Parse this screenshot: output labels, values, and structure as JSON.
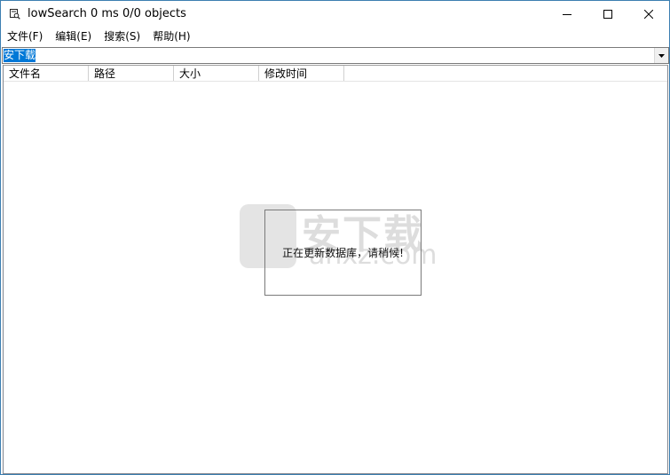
{
  "window": {
    "title": "lowSearch 0 ms 0/0 objects",
    "icon": "app-icon"
  },
  "menu": {
    "items": [
      {
        "label": "文件(F)"
      },
      {
        "label": "编辑(E)"
      },
      {
        "label": "搜索(S)"
      },
      {
        "label": "帮助(H)"
      }
    ]
  },
  "search": {
    "value": "安下载"
  },
  "list": {
    "columns": [
      {
        "label": "文件名"
      },
      {
        "label": "路径"
      },
      {
        "label": "大小"
      },
      {
        "label": "修改时间"
      }
    ]
  },
  "status": {
    "message": "正在更新数据库，请稍候!"
  },
  "watermark": {
    "text_cn": "安下载",
    "text_en": "anxz.com"
  },
  "colors": {
    "selection": "#0078d7",
    "window_border": "#3c7fb1"
  }
}
